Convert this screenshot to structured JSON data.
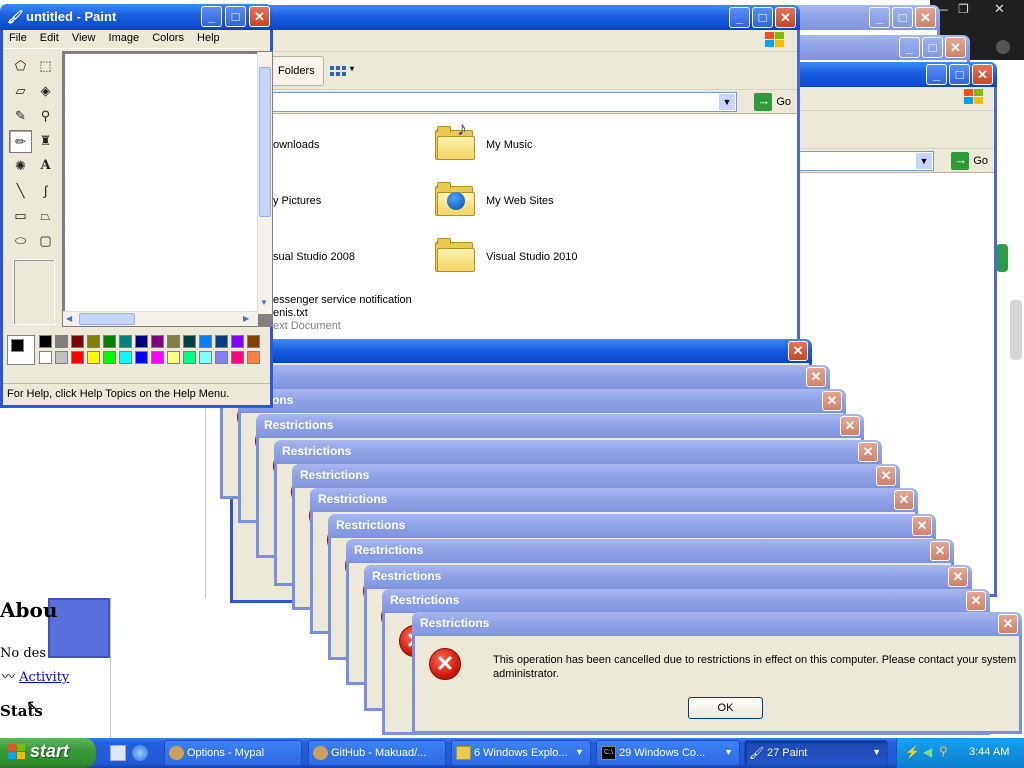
{
  "webpage": {
    "about_heading": "Abou",
    "desc_text": "No des",
    "activity_link": "Activity",
    "stats_heading": "Stats"
  },
  "explorer": {
    "folders_label": "Folders",
    "go_label": "Go",
    "items": [
      {
        "name": "ownloads",
        "sub": ""
      },
      {
        "name": "My Music",
        "sub": ""
      },
      {
        "name": "y Pictures",
        "sub": ""
      },
      {
        "name": "My Web Sites",
        "sub": ""
      },
      {
        "name": "sual Studio 2008",
        "sub": ""
      },
      {
        "name": "Visual Studio 2010",
        "sub": ""
      },
      {
        "name": "essenger service notification",
        "sub": "enis.txt",
        "sub2": "ext Document"
      }
    ]
  },
  "paint": {
    "title": "untitled - Paint",
    "menu": [
      "File",
      "Edit",
      "View",
      "Image",
      "Colors",
      "Help"
    ],
    "status": "For Help, click Help Topics on the Help Menu.",
    "tools": [
      "free-select",
      "rect-select",
      "eraser",
      "fill",
      "picker",
      "magnifier",
      "pencil",
      "brush",
      "airbrush",
      "text",
      "line",
      "curve",
      "rectangle",
      "polygon",
      "ellipse",
      "rounded-rect"
    ],
    "palette_top": [
      "#000000",
      "#808080",
      "#800000",
      "#808000",
      "#008000",
      "#008080",
      "#000080",
      "#800080",
      "#808040",
      "#004040",
      "#0080ff",
      "#004080",
      "#8000ff",
      "#804000"
    ],
    "palette_bottom": [
      "#ffffff",
      "#c0c0c0",
      "#ff0000",
      "#ffff00",
      "#00ff00",
      "#00ffff",
      "#0000ff",
      "#ff00ff",
      "#ffff80",
      "#00ff80",
      "#80ffff",
      "#8080ff",
      "#ff0080",
      "#ff8040"
    ],
    "fg_color": "#000000",
    "bg_color": "#ffffff"
  },
  "restrictions": {
    "first_title": "ions",
    "partial_title": "rictions",
    "partial_title2": "trictions",
    "title": "Restrictions",
    "message": "This operation has been cancelled due to restrictions in effect on this computer. Please contact your system administrator.",
    "ok_label": "OK"
  },
  "taskbar": {
    "start_label": "start",
    "tasks": [
      {
        "label": "Options - Mypal",
        "active": false
      },
      {
        "label": "GitHub - Makuad/...",
        "active": false
      },
      {
        "label": "6 Windows Explo...",
        "active": false
      },
      {
        "label": "29 Windows Co...",
        "active": false
      },
      {
        "label": "27 Paint",
        "active": true
      }
    ],
    "clock": "3:44 AM"
  }
}
